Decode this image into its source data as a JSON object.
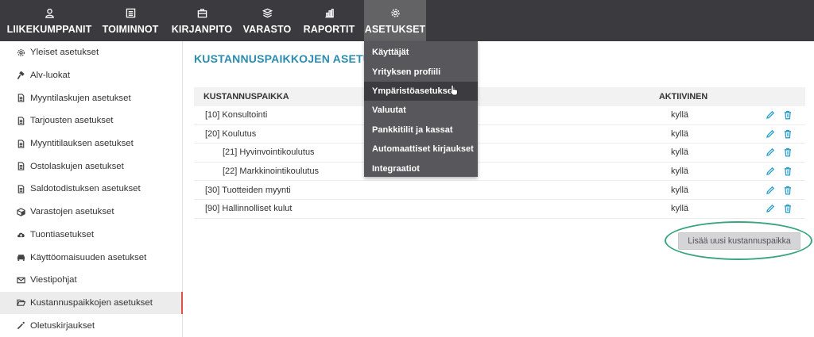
{
  "topnav": {
    "items": [
      {
        "label": "LIIKEKUMPPANIT",
        "icon": "person-icon"
      },
      {
        "label": "TOIMINNOT",
        "icon": "list-icon"
      },
      {
        "label": "KIRJANPITO",
        "icon": "briefcase-icon"
      },
      {
        "label": "VARASTO",
        "icon": "boxes-icon"
      },
      {
        "label": "RAPORTIT",
        "icon": "bar-chart-icon"
      },
      {
        "label": "ASETUKSET",
        "icon": "gear-icon"
      }
    ],
    "active": "ASETUKSET"
  },
  "dropdown": {
    "items": [
      "Käyttäjät",
      "Yrityksen profiili",
      "Ympäristöasetukset",
      "Valuutat",
      "Pankkitilit ja kassat",
      "Automaattiset kirjaukset",
      "Integraatiot"
    ],
    "hovered": "Ympäristöasetukset"
  },
  "sidebar": {
    "items": [
      {
        "label": "Yleiset asetukset",
        "icon": "gear-icon"
      },
      {
        "label": "Alv-luokat",
        "icon": "gavel-icon"
      },
      {
        "label": "Myyntilaskujen asetukset",
        "icon": "document-icon"
      },
      {
        "label": "Tarjousten asetukset",
        "icon": "document-icon"
      },
      {
        "label": "Myyntitilauksen asetukset",
        "icon": "document-icon"
      },
      {
        "label": "Ostolaskujen asetukset",
        "icon": "document-icon"
      },
      {
        "label": "Saldotodistuksen asetukset",
        "icon": "document-icon"
      },
      {
        "label": "Varastojen asetukset",
        "icon": "cube-icon"
      },
      {
        "label": "Tuontiasetukset",
        "icon": "cloud-upload-icon"
      },
      {
        "label": "Käyttöomaisuuden asetukset",
        "icon": "car-icon"
      },
      {
        "label": "Viestipohjat",
        "icon": "envelope-icon"
      },
      {
        "label": "Kustannuspaikkojen asetukset",
        "icon": "folder-open-icon"
      },
      {
        "label": "Oletuskirjaukset",
        "icon": "magic-wand-icon"
      }
    ],
    "active": "Kustannuspaikkojen asetukset"
  },
  "main": {
    "title": "KUSTANNUSPAIKKOJEN ASETUKSET",
    "table": {
      "headers": [
        "KUSTANNUSPAIKKA",
        "AKTIIVINEN"
      ],
      "rows": [
        {
          "name": "[10] Konsultointi",
          "active": "kyllä",
          "indent": false
        },
        {
          "name": "[20] Koulutus",
          "active": "kyllä",
          "indent": false
        },
        {
          "name": "[21] Hyvinvointikoulutus",
          "active": "kyllä",
          "indent": true
        },
        {
          "name": "[22] Markkinointikoulutus",
          "active": "kyllä",
          "indent": true
        },
        {
          "name": "[30] Tuotteiden myynti",
          "active": "kyllä",
          "indent": false
        },
        {
          "name": "[90] Hallinnolliset kulut",
          "active": "kyllä",
          "indent": false
        }
      ]
    },
    "add_button": "Lisää uusi kustannuspaikka"
  },
  "colors": {
    "nav_bg": "#3b3b3f",
    "accent_title": "#2b8cb0",
    "action_icon": "#2b9fc9",
    "highlight_ring": "#3aa57c",
    "active_marker": "#d9534f"
  }
}
